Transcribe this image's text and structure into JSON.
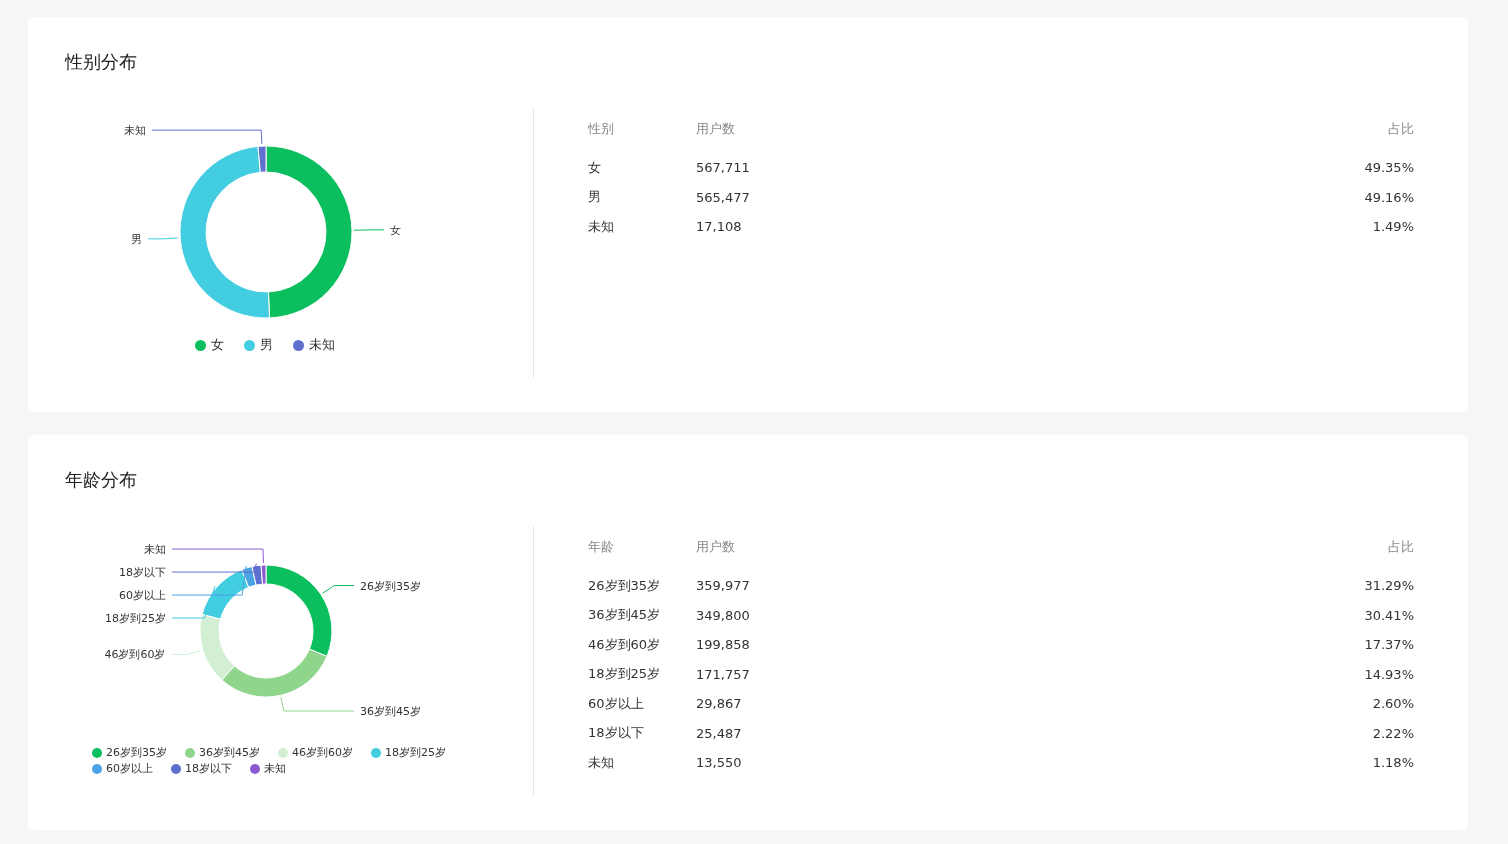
{
  "sections": [
    {
      "title": "性别分布",
      "chart_data": {
        "type": "donut",
        "categories": [
          "女",
          "男",
          "未知"
        ],
        "values": [
          49.35,
          49.16,
          1.49
        ]
      },
      "legend": [
        {
          "label": "女",
          "color": "#0bbf5f"
        },
        {
          "label": "男",
          "color": "#42cde0"
        },
        {
          "label": "未知",
          "color": "#5f6fcf"
        }
      ],
      "table": {
        "columns": [
          "性别",
          "用户数",
          "占比"
        ],
        "rows": [
          [
            "女",
            "567,711",
            "49.35%"
          ],
          [
            "男",
            "565,477",
            "49.16%"
          ],
          [
            "未知",
            "17,108",
            "1.49%"
          ]
        ]
      }
    },
    {
      "title": "年龄分布",
      "chart_data": {
        "type": "donut",
        "categories": [
          "26岁到35岁",
          "36岁到45岁",
          "46岁到60岁",
          "18岁到25岁",
          "60岁以上",
          "18岁以下",
          "未知"
        ],
        "values": [
          31.29,
          30.41,
          17.37,
          14.93,
          2.6,
          2.22,
          1.18
        ]
      },
      "legend": [
        {
          "label": "26岁到35岁",
          "color": "#0bbf5f"
        },
        {
          "label": "36岁到45岁",
          "color": "#8fd68c"
        },
        {
          "label": "46岁到60岁",
          "color": "#d2efd3"
        },
        {
          "label": "18岁到25岁",
          "color": "#42cde0"
        },
        {
          "label": "60岁以上",
          "color": "#4ba3e6"
        },
        {
          "label": "18岁以下",
          "color": "#5f6fcf"
        },
        {
          "label": "未知",
          "color": "#8a5bd0"
        }
      ],
      "table": {
        "columns": [
          "年龄",
          "用户数",
          "占比"
        ],
        "rows": [
          [
            "26岁到35岁",
            "359,977",
            "31.29%"
          ],
          [
            "36岁到45岁",
            "349,800",
            "30.41%"
          ],
          [
            "46岁到60岁",
            "199,858",
            "17.37%"
          ],
          [
            "18岁到25岁",
            "171,757",
            "14.93%"
          ],
          [
            "60岁以上",
            "29,867",
            "2.60%"
          ],
          [
            "18岁以下",
            "25,487",
            "2.22%"
          ],
          [
            "未知",
            "13,550",
            "1.18%"
          ]
        ]
      }
    }
  ]
}
